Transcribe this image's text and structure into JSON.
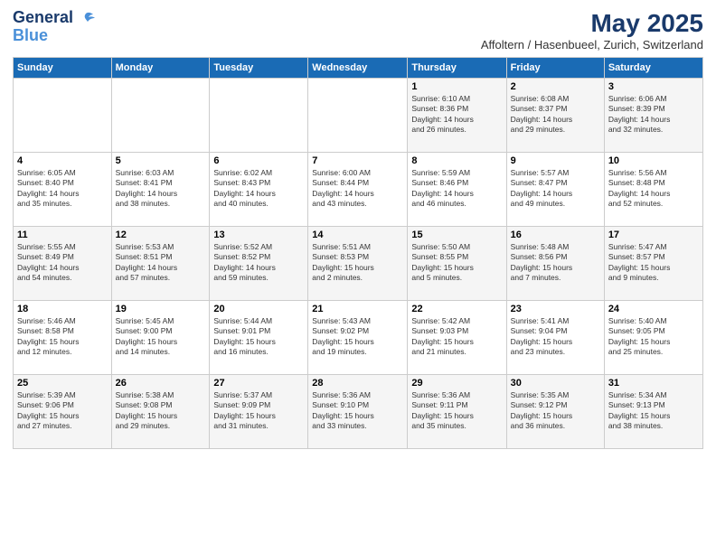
{
  "header": {
    "logo_line1": "General",
    "logo_line2": "Blue",
    "month_year": "May 2025",
    "location": "Affoltern / Hasenbueel, Zurich, Switzerland"
  },
  "days_of_week": [
    "Sunday",
    "Monday",
    "Tuesday",
    "Wednesday",
    "Thursday",
    "Friday",
    "Saturday"
  ],
  "weeks": [
    [
      {
        "day": "",
        "info": ""
      },
      {
        "day": "",
        "info": ""
      },
      {
        "day": "",
        "info": ""
      },
      {
        "day": "",
        "info": ""
      },
      {
        "day": "1",
        "info": "Sunrise: 6:10 AM\nSunset: 8:36 PM\nDaylight: 14 hours\nand 26 minutes."
      },
      {
        "day": "2",
        "info": "Sunrise: 6:08 AM\nSunset: 8:37 PM\nDaylight: 14 hours\nand 29 minutes."
      },
      {
        "day": "3",
        "info": "Sunrise: 6:06 AM\nSunset: 8:39 PM\nDaylight: 14 hours\nand 32 minutes."
      }
    ],
    [
      {
        "day": "4",
        "info": "Sunrise: 6:05 AM\nSunset: 8:40 PM\nDaylight: 14 hours\nand 35 minutes."
      },
      {
        "day": "5",
        "info": "Sunrise: 6:03 AM\nSunset: 8:41 PM\nDaylight: 14 hours\nand 38 minutes."
      },
      {
        "day": "6",
        "info": "Sunrise: 6:02 AM\nSunset: 8:43 PM\nDaylight: 14 hours\nand 40 minutes."
      },
      {
        "day": "7",
        "info": "Sunrise: 6:00 AM\nSunset: 8:44 PM\nDaylight: 14 hours\nand 43 minutes."
      },
      {
        "day": "8",
        "info": "Sunrise: 5:59 AM\nSunset: 8:46 PM\nDaylight: 14 hours\nand 46 minutes."
      },
      {
        "day": "9",
        "info": "Sunrise: 5:57 AM\nSunset: 8:47 PM\nDaylight: 14 hours\nand 49 minutes."
      },
      {
        "day": "10",
        "info": "Sunrise: 5:56 AM\nSunset: 8:48 PM\nDaylight: 14 hours\nand 52 minutes."
      }
    ],
    [
      {
        "day": "11",
        "info": "Sunrise: 5:55 AM\nSunset: 8:49 PM\nDaylight: 14 hours\nand 54 minutes."
      },
      {
        "day": "12",
        "info": "Sunrise: 5:53 AM\nSunset: 8:51 PM\nDaylight: 14 hours\nand 57 minutes."
      },
      {
        "day": "13",
        "info": "Sunrise: 5:52 AM\nSunset: 8:52 PM\nDaylight: 14 hours\nand 59 minutes."
      },
      {
        "day": "14",
        "info": "Sunrise: 5:51 AM\nSunset: 8:53 PM\nDaylight: 15 hours\nand 2 minutes."
      },
      {
        "day": "15",
        "info": "Sunrise: 5:50 AM\nSunset: 8:55 PM\nDaylight: 15 hours\nand 5 minutes."
      },
      {
        "day": "16",
        "info": "Sunrise: 5:48 AM\nSunset: 8:56 PM\nDaylight: 15 hours\nand 7 minutes."
      },
      {
        "day": "17",
        "info": "Sunrise: 5:47 AM\nSunset: 8:57 PM\nDaylight: 15 hours\nand 9 minutes."
      }
    ],
    [
      {
        "day": "18",
        "info": "Sunrise: 5:46 AM\nSunset: 8:58 PM\nDaylight: 15 hours\nand 12 minutes."
      },
      {
        "day": "19",
        "info": "Sunrise: 5:45 AM\nSunset: 9:00 PM\nDaylight: 15 hours\nand 14 minutes."
      },
      {
        "day": "20",
        "info": "Sunrise: 5:44 AM\nSunset: 9:01 PM\nDaylight: 15 hours\nand 16 minutes."
      },
      {
        "day": "21",
        "info": "Sunrise: 5:43 AM\nSunset: 9:02 PM\nDaylight: 15 hours\nand 19 minutes."
      },
      {
        "day": "22",
        "info": "Sunrise: 5:42 AM\nSunset: 9:03 PM\nDaylight: 15 hours\nand 21 minutes."
      },
      {
        "day": "23",
        "info": "Sunrise: 5:41 AM\nSunset: 9:04 PM\nDaylight: 15 hours\nand 23 minutes."
      },
      {
        "day": "24",
        "info": "Sunrise: 5:40 AM\nSunset: 9:05 PM\nDaylight: 15 hours\nand 25 minutes."
      }
    ],
    [
      {
        "day": "25",
        "info": "Sunrise: 5:39 AM\nSunset: 9:06 PM\nDaylight: 15 hours\nand 27 minutes."
      },
      {
        "day": "26",
        "info": "Sunrise: 5:38 AM\nSunset: 9:08 PM\nDaylight: 15 hours\nand 29 minutes."
      },
      {
        "day": "27",
        "info": "Sunrise: 5:37 AM\nSunset: 9:09 PM\nDaylight: 15 hours\nand 31 minutes."
      },
      {
        "day": "28",
        "info": "Sunrise: 5:36 AM\nSunset: 9:10 PM\nDaylight: 15 hours\nand 33 minutes."
      },
      {
        "day": "29",
        "info": "Sunrise: 5:36 AM\nSunset: 9:11 PM\nDaylight: 15 hours\nand 35 minutes."
      },
      {
        "day": "30",
        "info": "Sunrise: 5:35 AM\nSunset: 9:12 PM\nDaylight: 15 hours\nand 36 minutes."
      },
      {
        "day": "31",
        "info": "Sunrise: 5:34 AM\nSunset: 9:13 PM\nDaylight: 15 hours\nand 38 minutes."
      }
    ]
  ]
}
